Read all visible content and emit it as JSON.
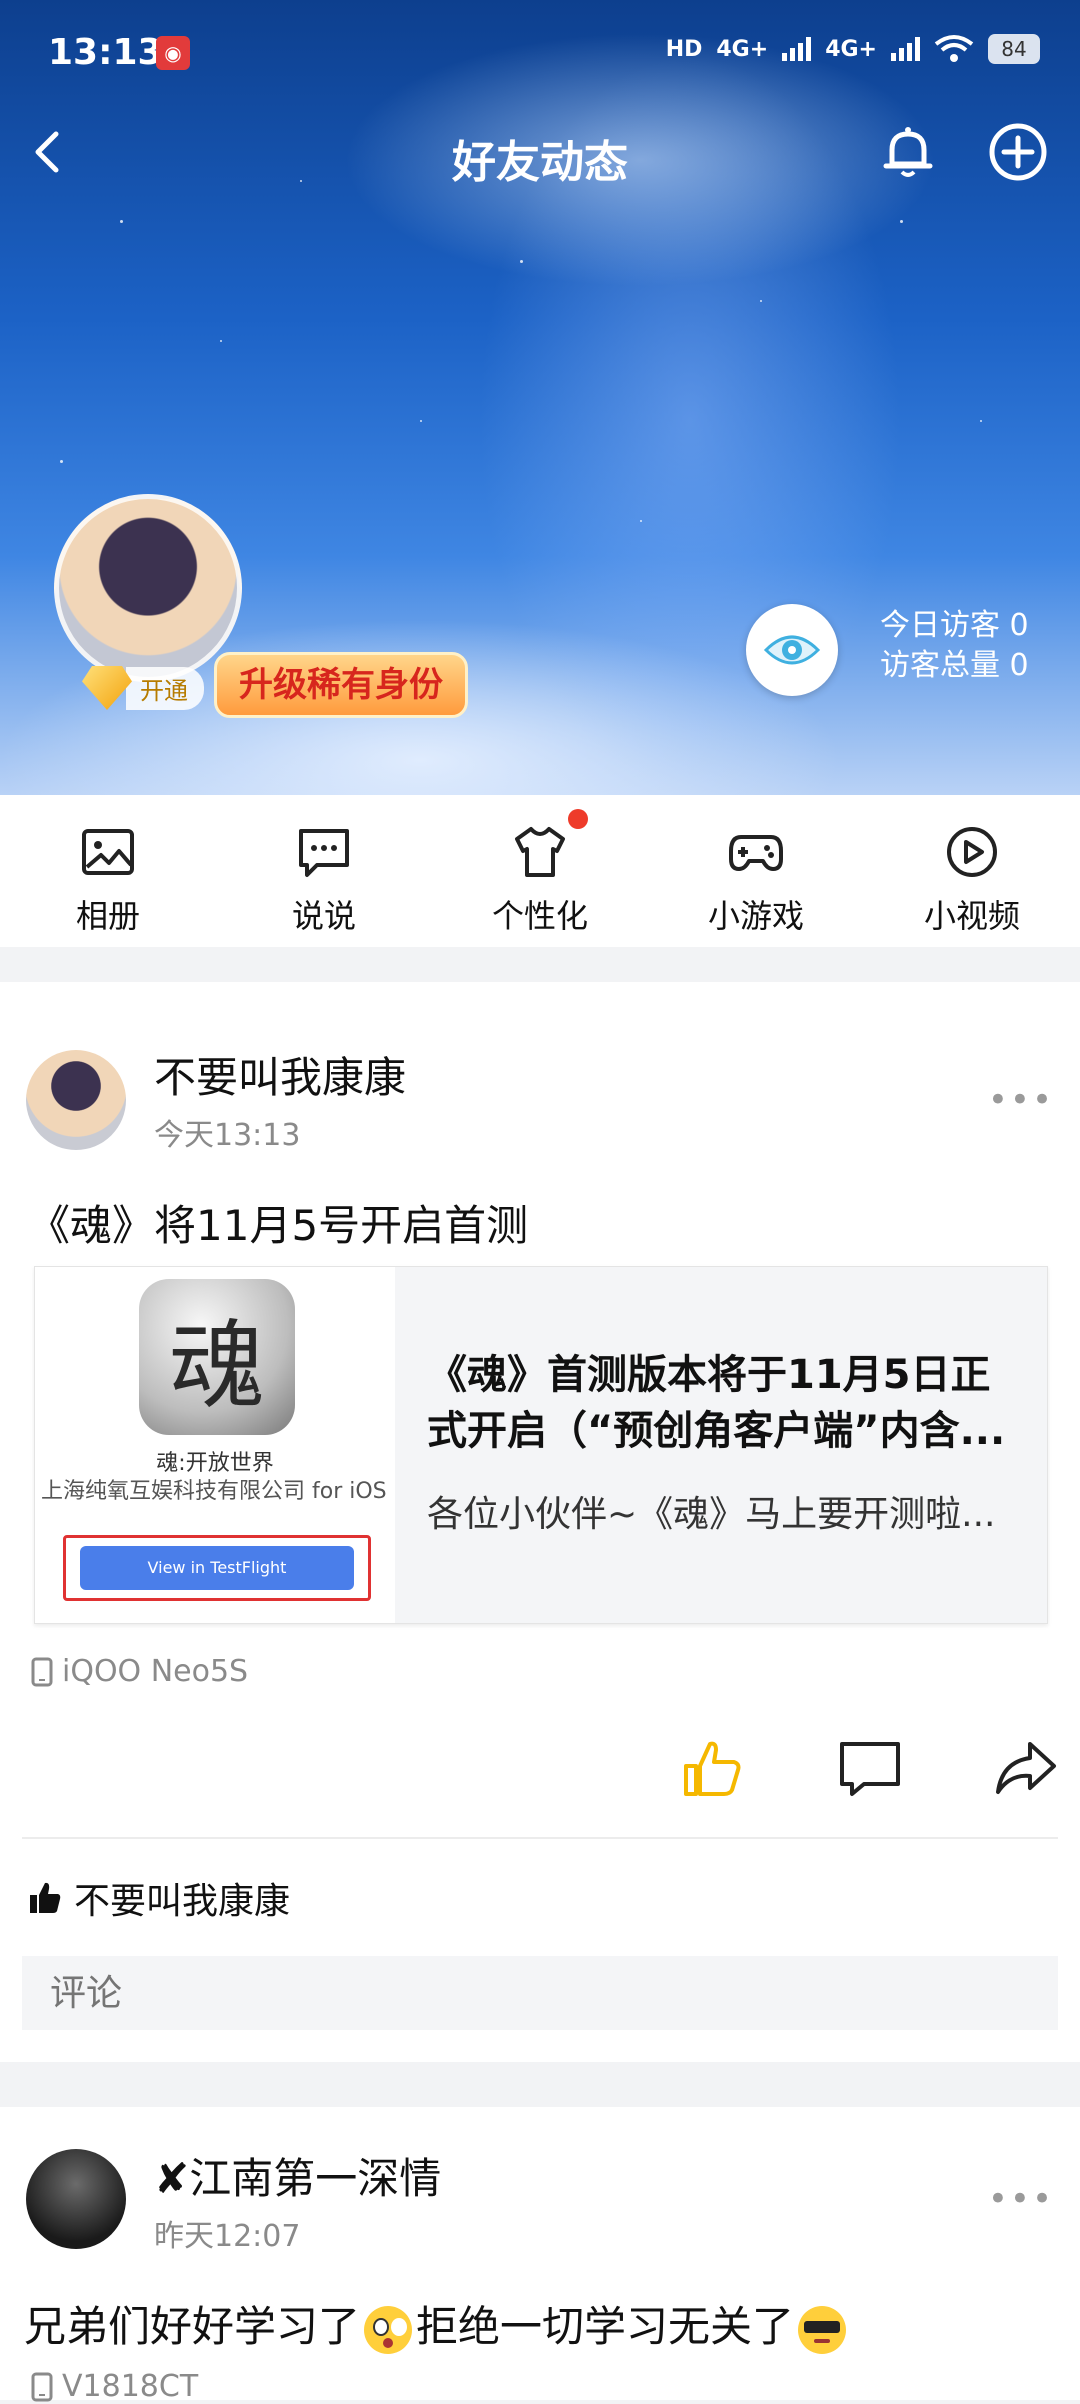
{
  "status_bar": {
    "time": "13:13",
    "hd_label": "HD",
    "net1": "4G+",
    "net2": "4G+",
    "battery": "84"
  },
  "nav": {
    "title": "好友动态"
  },
  "profile": {
    "vip_open_label": "开通",
    "upgrade_label": "升级稀有身份",
    "visitors_today": "今日访客 0",
    "visitors_total": "访客总量 0"
  },
  "tabs": [
    {
      "label": "相册",
      "icon": "photo-icon"
    },
    {
      "label": "说说",
      "icon": "chat-icon"
    },
    {
      "label": "个性化",
      "icon": "tshirt-icon"
    },
    {
      "label": "小游戏",
      "icon": "gamepad-icon"
    },
    {
      "label": "小视频",
      "icon": "play-icon"
    }
  ],
  "posts": [
    {
      "author": "不要叫我康康",
      "time": "今天13:13",
      "text": "《魂》将11月5号开启首测",
      "card": {
        "game_name": "魂:开放世界",
        "developer": "上海纯氧互娱科技有限公司 for iOS",
        "button_label": "View in TestFlight",
        "title": "《魂》首测版本将于11月5日正式开启（“预创角客户端”内含...",
        "subtitle": "各位小伙伴~《魂》马上要开测啦..."
      },
      "device": "iQOO Neo5S",
      "liked_by": "不要叫我康康",
      "comment_placeholder": "评论"
    },
    {
      "author": "✘江南第一深情",
      "time": "昨天12:07",
      "text_part1": "兄弟们好好学习了",
      "text_part2": "拒绝一切学习无关了",
      "device": "V1818CT"
    }
  ],
  "colors": {
    "accent_blue": "#4a7eea",
    "like_yellow": "#f5b800",
    "red_dot": "#ee3b2a"
  }
}
